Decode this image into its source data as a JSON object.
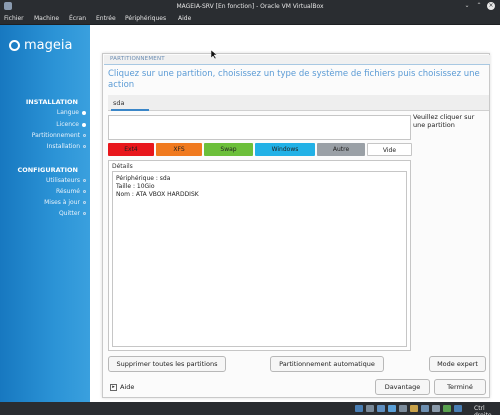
{
  "window": {
    "title": "MAGEIA-SRV [En fonction] - Oracle VM VirtualBox"
  },
  "menubar": [
    "Fichier",
    "Machine",
    "Écran",
    "Entrée",
    "Périphériques",
    "Aide"
  ],
  "sidebar": {
    "logo_text": "mageia",
    "sections": [
      {
        "title": "INSTALLATION",
        "items": [
          {
            "label": "Langue",
            "state": "done"
          },
          {
            "label": "Licence",
            "state": "done"
          },
          {
            "label": "Partitionnement",
            "state": "current"
          },
          {
            "label": "Installation",
            "state": "pending"
          }
        ]
      },
      {
        "title": "CONFIGURATION",
        "items": [
          {
            "label": "Utilisateurs",
            "state": "pending"
          },
          {
            "label": "Résumé",
            "state": "pending"
          },
          {
            "label": "Mises à jour",
            "state": "pending"
          },
          {
            "label": "Quitter",
            "state": "pending"
          }
        ]
      }
    ]
  },
  "panel": {
    "header": "PARTITIONNEMENT",
    "instruction": "Cliquez sur une partition, choisissez un type de système de fichiers puis choisissez une action",
    "disk_tab": "sda",
    "partition_hint": "Veuillez cliquer sur une partition",
    "fs_types": [
      {
        "label": "Ext4",
        "color": "#e8161c"
      },
      {
        "label": "XFS",
        "color": "#f07a1f"
      },
      {
        "label": "Swap",
        "color": "#6cbf3a"
      },
      {
        "label": "Windows",
        "color": "#22b1e6"
      },
      {
        "label": "Autre",
        "color": "#9aa0a6"
      },
      {
        "label": "Vide",
        "color": "#ffffff"
      }
    ],
    "details": {
      "title": "Détails",
      "lines": [
        "Périphérique : sda",
        "Taille : 10Gio",
        "Nom : ATA VBOX HARDDISK"
      ]
    },
    "actions": {
      "delete_all": "Supprimer toutes les partitions",
      "auto": "Partitionnement automatique",
      "expert": "Mode expert"
    },
    "help": "Aide",
    "footer": {
      "more": "Davantage",
      "done": "Terminé"
    }
  },
  "statusbar": {
    "host_key": "Ctrl droite"
  }
}
